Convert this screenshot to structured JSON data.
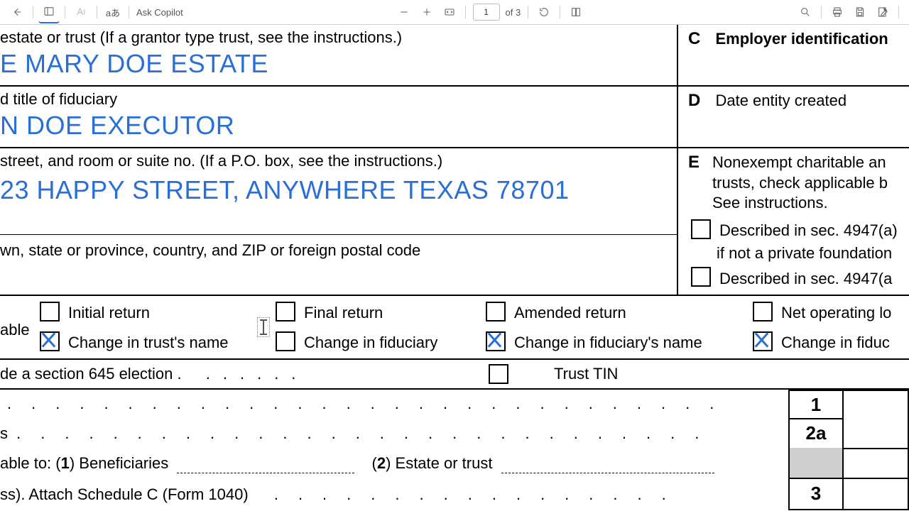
{
  "toolbar": {
    "copilot": "Ask Copilot",
    "translate_glyph": "aあ",
    "page_current": "1",
    "page_total": "of 3"
  },
  "form": {
    "name_label": "estate or trust (If a grantor type trust, see the instructions.)",
    "name_value": "E MARY DOE ESTATE",
    "fiduciary_label": "d title of fiduciary",
    "fiduciary_value": "N DOE EXECUTOR",
    "street_label": "street, and room or suite no. (If a P.O. box, see the instructions.)",
    "street_value": "23 HAPPY STREET, ANYWHERE TEXAS 78701",
    "city_label": "wn, state or province, country, and ZIP or foreign postal code",
    "c_letter": "C",
    "c_text": "Employer identification",
    "d_letter": "D",
    "d_text": "Date entity created",
    "e_letter": "E",
    "e_text1": "Nonexempt charitable an",
    "e_text2": "trusts, check applicable b",
    "e_text3": "See instructions.",
    "e_opt1": "Described in sec. 4947(a)",
    "e_opt1b": "if not a private foundation",
    "e_opt2": "Described in sec. 4947(a",
    "f_left": "able",
    "cb": {
      "initial": "Initial return",
      "final": "Final return",
      "amended": "Amended return",
      "nol": "Net operating lo",
      "chg_trust": "Change in trust's name",
      "chg_fid": "Change in fiduciary",
      "chg_fid_name": "Change in fiduciary's name",
      "chg_fid_addr": "Change in fiduc"
    },
    "g_line": "de a section 645 election .",
    "g_dots": "......",
    "trust_tin": "Trust TIN",
    "line2b": "able to:  (",
    "line2b_1n": "1",
    "line2b_1": ") Beneficiaries",
    "line2b_2n": "2",
    "line2b_2": ") Estate or trust",
    "line3": "ss). Attach Schedule C (Form 1040)",
    "row2a_s": "s",
    "num1": "1",
    "num2a": "2a",
    "num3": "3"
  }
}
